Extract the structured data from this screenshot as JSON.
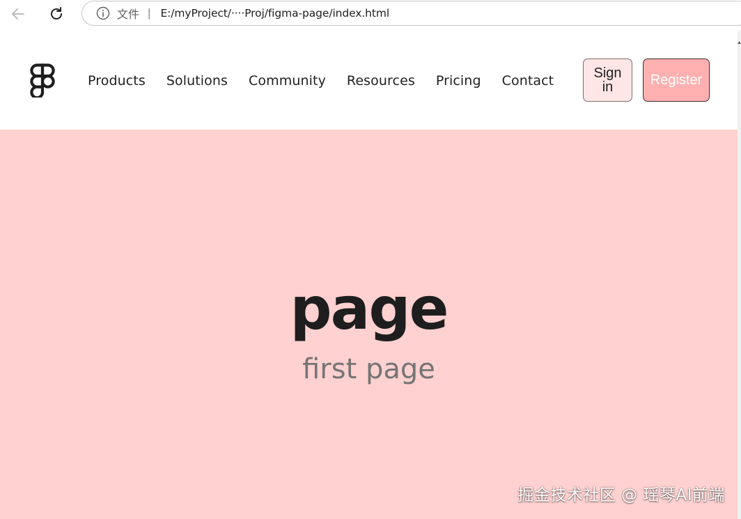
{
  "browser": {
    "address_bar": {
      "protocol_label": "文件",
      "separator": "|",
      "url": "E:/myProject/····Proj/figma-page/index.html"
    },
    "icons": {
      "back": "arrow-left-icon",
      "reload": "reload-icon",
      "info": "info-circle-icon"
    }
  },
  "header": {
    "logo_icon": "figma-logo-icon",
    "nav": [
      {
        "label": "Products"
      },
      {
        "label": "Solutions"
      },
      {
        "label": "Community"
      },
      {
        "label": "Resources"
      },
      {
        "label": "Pricing"
      },
      {
        "label": "Contact"
      }
    ],
    "sign_in_label": "Sign in",
    "register_label": "Register"
  },
  "hero": {
    "title": "page",
    "subtitle": "first page"
  },
  "watermark": "掘金技术社区 @ 瑶琴AI前端",
  "colors": {
    "hero_background": "#ffd1d0",
    "sign_in_background": "#ffe6e6",
    "register_background": "#ffb0b0",
    "text_primary": "#1e1e1e",
    "text_secondary": "#757575"
  }
}
